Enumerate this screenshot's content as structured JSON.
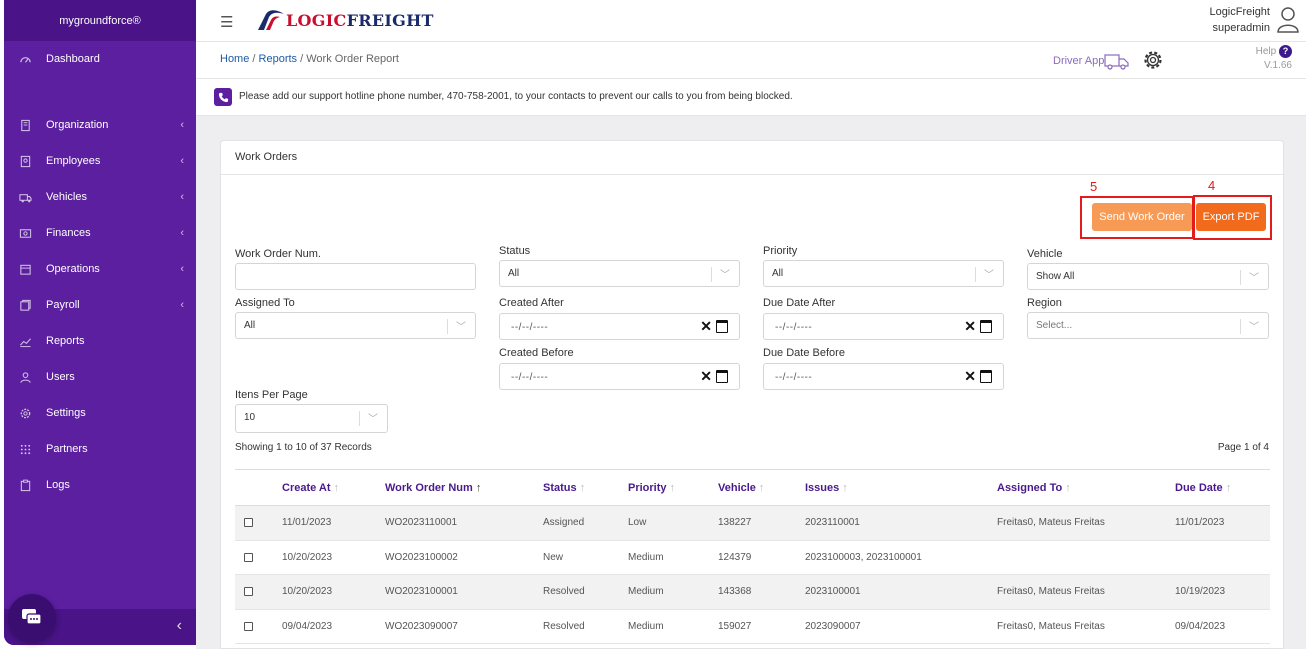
{
  "sidebar": {
    "brand": "mygroundforce®",
    "items": [
      {
        "label": "Dashboard",
        "icon": "dashboard-icon"
      },
      {
        "label": "Organization",
        "icon": "building-icon"
      },
      {
        "label": "Employees",
        "icon": "employees-icon"
      },
      {
        "label": "Vehicles",
        "icon": "truck-icon"
      },
      {
        "label": "Finances",
        "icon": "finances-icon"
      },
      {
        "label": "Operations",
        "icon": "calendar-icon"
      },
      {
        "label": "Payroll",
        "icon": "payroll-icon"
      },
      {
        "label": "Reports",
        "icon": "chart-icon"
      },
      {
        "label": "Users",
        "icon": "users-icon"
      },
      {
        "label": "Settings",
        "icon": "gear-icon"
      },
      {
        "label": "Partners",
        "icon": "grid-icon"
      },
      {
        "label": "Logs",
        "icon": "clipboard-icon"
      }
    ]
  },
  "header": {
    "logo_part1": "LOGIC",
    "logo_part2": "FREIGHT",
    "company": "LogicFreight",
    "username": "superadmin"
  },
  "breadcrumb": {
    "home": "Home",
    "reports": "Reports",
    "current": "Work Order Report",
    "sep": "/"
  },
  "toolbar": {
    "driver_app": "Driver App",
    "help": "Help",
    "version": "V.1.66"
  },
  "notice": {
    "text": "Please add our support hotline phone number, 470-758-2001, to your contacts to prevent our calls to you from being blocked."
  },
  "card": {
    "title": "Work Orders",
    "send_button": "Send Work Order",
    "export_button": "Export PDF",
    "annotation_send": "5",
    "annotation_export": "4"
  },
  "filters": {
    "work_order_num": {
      "label": "Work Order Num.",
      "value": ""
    },
    "status": {
      "label": "Status",
      "value": "All"
    },
    "priority": {
      "label": "Priority",
      "value": "All"
    },
    "vehicle": {
      "label": "Vehicle",
      "value": "Show All"
    },
    "assigned_to": {
      "label": "Assigned To",
      "value": "All"
    },
    "created_after": {
      "label": "Created After",
      "placeholder": "--/--/----"
    },
    "due_date_after": {
      "label": "Due Date After",
      "placeholder": "--/--/----"
    },
    "region": {
      "label": "Region",
      "placeholder": "Select..."
    },
    "created_before": {
      "label": "Created Before",
      "placeholder": "--/--/----"
    },
    "due_date_before": {
      "label": "Due Date Before",
      "placeholder": "--/--/----"
    },
    "items_per_page": {
      "label": "Itens Per Page",
      "value": "10"
    }
  },
  "records": {
    "showing": "Showing 1 to 10 of 37 Records",
    "page": "Page 1 of 4"
  },
  "table": {
    "headers": [
      "Create At",
      "Work Order Num",
      "Status",
      "Priority",
      "Vehicle",
      "Issues",
      "Assigned To",
      "Due Date"
    ],
    "rows": [
      [
        "11/01/2023",
        "WO2023110001",
        "Assigned",
        "Low",
        "138227",
        "2023110001",
        "Freitas0, Mateus Freitas",
        "11/01/2023"
      ],
      [
        "10/20/2023",
        "WO2023100002",
        "New",
        "Medium",
        "124379",
        "2023100003, 2023100001",
        "",
        ""
      ],
      [
        "10/20/2023",
        "WO2023100001",
        "Resolved",
        "Medium",
        "143368",
        "2023100001",
        "Freitas0, Mateus Freitas",
        "10/19/2023"
      ],
      [
        "09/04/2023",
        "WO2023090007",
        "Resolved",
        "Medium",
        "159027",
        "2023090007",
        "Freitas0, Mateus Freitas",
        "09/04/2023"
      ]
    ]
  }
}
